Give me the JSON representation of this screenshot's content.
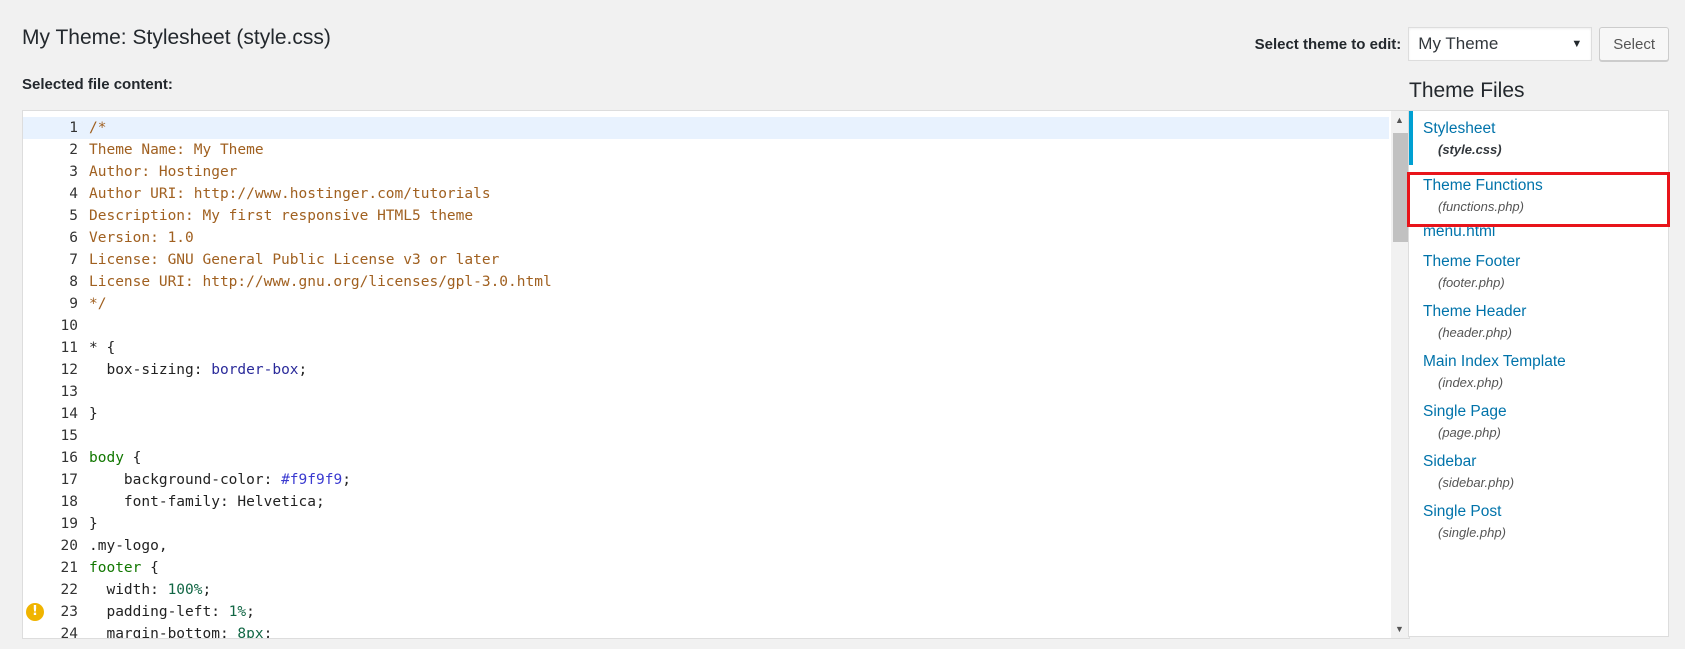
{
  "header": {
    "title": "My Theme: Stylesheet (style.css)",
    "select_label": "Select theme to edit:",
    "selected_theme": "My Theme",
    "select_button": "Select"
  },
  "editor": {
    "label": "Selected file content:",
    "active_line": 1,
    "warning_line": 23,
    "lines": [
      [
        [
          "/*",
          "c-comment"
        ]
      ],
      [
        [
          "Theme Name: My Theme",
          "c-comment"
        ]
      ],
      [
        [
          "Author: Hostinger",
          "c-comment"
        ]
      ],
      [
        [
          "Author URI: http://www.hostinger.com/tutorials",
          "c-comment"
        ]
      ],
      [
        [
          "Description: My first responsive HTML5 theme",
          "c-comment"
        ]
      ],
      [
        [
          "Version: 1.0",
          "c-comment"
        ]
      ],
      [
        [
          "License: GNU General Public License v3 or later",
          "c-comment"
        ]
      ],
      [
        [
          "License URI: http://www.gnu.org/licenses/gpl-3.0.html",
          "c-comment"
        ]
      ],
      [
        [
          "*/",
          "c-comment"
        ]
      ],
      [],
      [
        [
          "* ",
          "c-punc"
        ],
        [
          "{",
          "c-punc"
        ]
      ],
      [
        [
          "  box-sizing",
          "c-prop"
        ],
        [
          ": ",
          "c-punc"
        ],
        [
          "border-box",
          "c-val"
        ],
        [
          ";",
          "c-punc"
        ]
      ],
      [],
      [
        [
          "}",
          "c-punc"
        ]
      ],
      [],
      [
        [
          "body",
          "c-sel"
        ],
        [
          " {",
          "c-punc"
        ]
      ],
      [
        [
          "    background-color",
          "c-prop"
        ],
        [
          ": ",
          "c-punc"
        ],
        [
          "#f9f9f9",
          "c-hex"
        ],
        [
          ";",
          "c-punc"
        ]
      ],
      [
        [
          "    font-family",
          "c-prop"
        ],
        [
          ": ",
          "c-punc"
        ],
        [
          "Helvetica",
          "c-prop"
        ],
        [
          ";",
          "c-punc"
        ]
      ],
      [
        [
          "}",
          "c-punc"
        ]
      ],
      [
        [
          ".my-logo",
          "c-prop"
        ],
        [
          ",",
          "c-punc"
        ]
      ],
      [
        [
          "footer",
          "c-sel"
        ],
        [
          " {",
          "c-punc"
        ]
      ],
      [
        [
          "  width",
          "c-prop"
        ],
        [
          ": ",
          "c-punc"
        ],
        [
          "100%",
          "c-num"
        ],
        [
          ";",
          "c-punc"
        ]
      ],
      [
        [
          "  padding-left",
          "c-prop"
        ],
        [
          ": ",
          "c-punc"
        ],
        [
          "1%",
          "c-num"
        ],
        [
          ";",
          "c-punc"
        ]
      ],
      [
        [
          "  margin-bottom",
          "c-prop"
        ],
        [
          ": ",
          "c-punc"
        ],
        [
          "8px",
          "c-num"
        ],
        [
          ";",
          "c-punc"
        ]
      ]
    ]
  },
  "sidebar": {
    "title": "Theme Files",
    "files": [
      {
        "label": "Stylesheet",
        "file": "(style.css)",
        "current": true
      },
      {
        "label": "Theme Functions",
        "file": "(functions.php)",
        "highlighted": true
      },
      {
        "label": "menu.html",
        "file": ""
      },
      {
        "label": "Theme Footer",
        "file": "(footer.php)"
      },
      {
        "label": "Theme Header",
        "file": "(header.php)"
      },
      {
        "label": "Main Index Template",
        "file": "(index.php)"
      },
      {
        "label": "Single Page",
        "file": "(page.php)"
      },
      {
        "label": "Sidebar",
        "file": "(sidebar.php)"
      },
      {
        "label": "Single Post",
        "file": "(single.php)"
      }
    ]
  },
  "colors": {
    "accent": "#00a0d2",
    "link": "#0073aa",
    "highlight": "#e8141a",
    "warning": "#f0b400"
  },
  "icons": {
    "warning": "warning-icon",
    "dropdown": "chevron-down-icon"
  }
}
